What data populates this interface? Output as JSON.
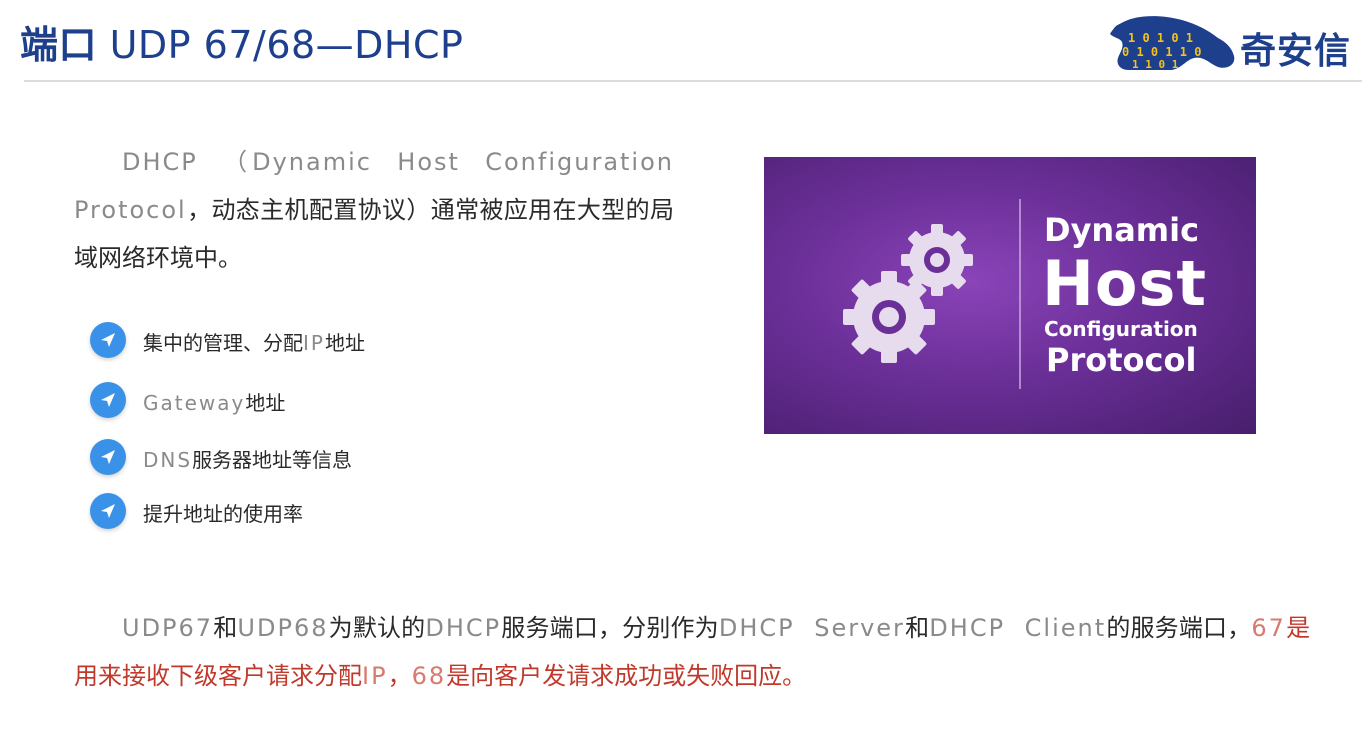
{
  "slide": {
    "title_bold": "端口",
    "title_rest": " UDP 67/68—DHCP",
    "logo_text": "奇安信"
  },
  "intro": {
    "p1": "DHCP  （Dynamic  Host  Configuration Protocol",
    "p2": "，动态主机配置协议）通常被应用在大型的局域网络环境中。"
  },
  "bullets": [
    {
      "icon": "paper-plane-icon",
      "cn1": "集中的管理、分配",
      "en": "IP",
      "cn2": "地址"
    },
    {
      "icon": "paper-plane-icon",
      "cn1": "",
      "en": "Gateway",
      "cn2": "地址"
    },
    {
      "icon": "paper-plane-icon",
      "cn1": "",
      "en": "DNS",
      "cn2": "服务器地址等信息"
    },
    {
      "icon": "paper-plane-icon",
      "cn1": "提升地址的使用率",
      "en": "",
      "cn2": ""
    }
  ],
  "banner": {
    "line1": "Dynamic",
    "line2": "Host",
    "line3": "Configuration",
    "line4": "Protocol",
    "icon": "gears-icon"
  },
  "footnote": {
    "s1": "UDP67",
    "s2": "和",
    "s3": "UDP68",
    "s4": "为默认的",
    "s5": "DHCP",
    "s6": "服务端口，分别作为",
    "s7": "DHCP  Server",
    "s8": "和",
    "s9": "DHCP  Client",
    "s10": "的服务端口，",
    "r1": "67",
    "r2": "是用来接收下级客户请求分配",
    "r3": "IP",
    "r4": "，",
    "r5": "68",
    "r6": "是向客户发请求成功或失败回应。"
  },
  "colors": {
    "title": "#1d3f8c",
    "accent_red": "#c0392b",
    "bullet_blue": "#3a92e8",
    "banner_purple": "#6b2f98"
  }
}
